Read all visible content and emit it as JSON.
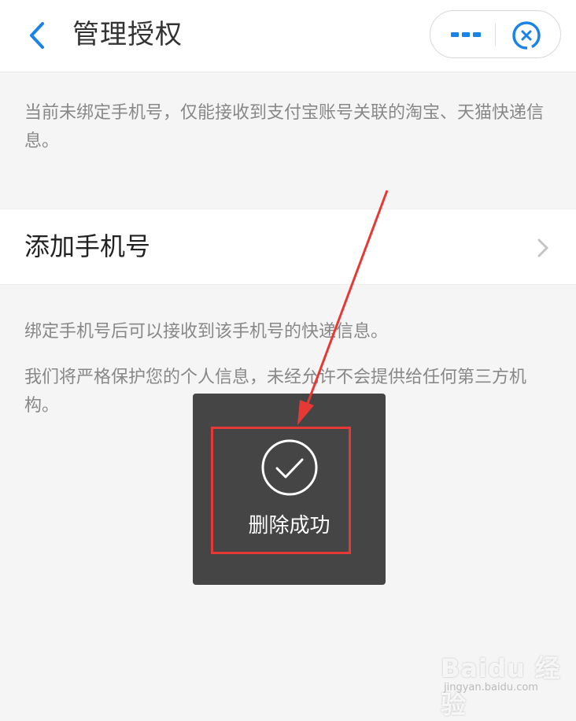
{
  "header": {
    "title": "管理授权"
  },
  "notice": "当前未绑定手机号，仅能接收到支付宝账号关联的淘宝、天猫快递信息。",
  "add_phone": {
    "label": "添加手机号"
  },
  "info": {
    "line1": "绑定手机号后可以接收到该手机号的快递信息。",
    "line2": "我们将严格保护您的个人信息，未经允许不会提供给任何第三方机构。"
  },
  "toast": {
    "text": "删除成功"
  },
  "watermark": {
    "brand": "Baidu 经验",
    "site": "jingyan.baidu.com"
  },
  "icons": {
    "back": "chevron-left-icon",
    "more": "more-dots-icon",
    "close": "close-circle-icon",
    "row_arrow": "chevron-right-icon",
    "toast": "check-circle-icon"
  },
  "colors": {
    "accent_blue": "#1a83e8",
    "background": "#f5f5f5",
    "toast_bg": "#454545",
    "annotation_red": "#e53935"
  }
}
